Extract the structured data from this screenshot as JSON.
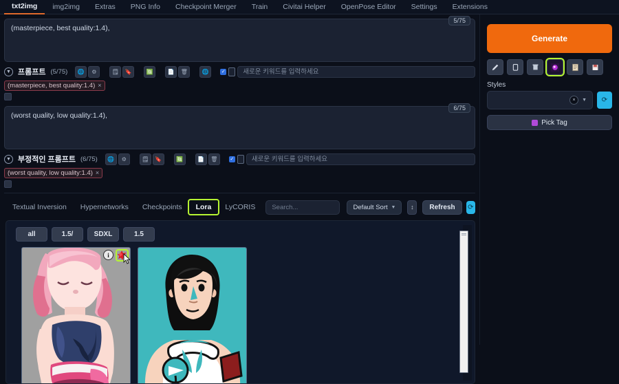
{
  "topbar": {
    "tabs": [
      {
        "label": "txt2img",
        "active": true
      },
      {
        "label": "img2img",
        "active": false
      },
      {
        "label": "Extras",
        "active": false
      },
      {
        "label": "PNG Info",
        "active": false
      },
      {
        "label": "Checkpoint Merger",
        "active": false
      },
      {
        "label": "Train",
        "active": false
      },
      {
        "label": "Civitai Helper",
        "active": false
      },
      {
        "label": "OpenPose Editor",
        "active": false
      },
      {
        "label": "Settings",
        "active": false
      },
      {
        "label": "Extensions",
        "active": false
      }
    ]
  },
  "prompt": {
    "counter": "5/75",
    "text": "(masterpiece, best quality:1.4),",
    "label": "프롬프트",
    "count": "(5/75)",
    "keyword_placeholder": "새로운 키워드를 입력하세요",
    "chip": "(masterpiece, best quality:1.4)",
    "chip_remove": "×",
    "icons": [
      "globe-icon",
      "gear-icon",
      "read-generation-params-icon",
      "bookmark-icon",
      "translate-icon",
      "copy-icon",
      "trash-icon",
      "globe-translate-icon"
    ]
  },
  "negative_prompt": {
    "counter": "6/75",
    "text": "(worst quality, low quality:1.4),",
    "label": "부정적인 프롬프트",
    "count": "(6/75)",
    "keyword_placeholder": "새로운 키워드를 입력하세요",
    "chip": "(worst quality, low quality:1.4)",
    "chip_remove": "×",
    "icons": [
      "globe-icon",
      "gear-icon",
      "read-generation-params-icon",
      "bookmark-icon",
      "translate-icon",
      "copy-icon",
      "trash-icon"
    ]
  },
  "extra_networks": {
    "tabs": [
      {
        "label": "Textual Inversion",
        "active": false
      },
      {
        "label": "Hypernetworks",
        "active": false
      },
      {
        "label": "Checkpoints",
        "active": false
      },
      {
        "label": "Lora",
        "active": true
      },
      {
        "label": "LyCORIS",
        "active": false
      }
    ],
    "search_placeholder": "Search...",
    "sort_value": "Default Sort",
    "sort_caret": "▼",
    "sort_direction_icon": "↕",
    "refresh_label": "Refresh",
    "sync_icon": "⟳",
    "filters": [
      "all",
      "1.5/",
      "SDXL",
      "1.5"
    ],
    "cards": [
      {
        "name": "lora-card-1",
        "info_icon": "i",
        "action_icon": "red-star-icon"
      },
      {
        "name": "lora-card-2"
      }
    ]
  },
  "right_panel": {
    "generate_label": "Generate",
    "tool_buttons": [
      {
        "name": "interrupt-paintbrush-icon",
        "glyph": "✎",
        "highlighted": false
      },
      {
        "name": "clipboard-icon",
        "glyph": "❐",
        "highlighted": false
      },
      {
        "name": "clear-prompt-trash-icon",
        "glyph": "🗑",
        "highlighted": false
      },
      {
        "name": "extra-networks-icon",
        "glyph": "◉",
        "highlighted": true
      },
      {
        "name": "apply-style-icon",
        "glyph": "📋",
        "highlighted": false
      },
      {
        "name": "save-style-icon",
        "glyph": "💾",
        "highlighted": false
      }
    ],
    "styles_label": "Styles",
    "styles_value": "",
    "styles_clear_icon": "×",
    "styles_caret": "▼",
    "styles_refresh_icon": "⟳",
    "pick_tag_label": "Pick Tag"
  },
  "colors": {
    "accent_orange": "#f0690d",
    "highlight_green": "#b6f532",
    "cyan": "#29b6e8",
    "background": "#0b0f19"
  }
}
